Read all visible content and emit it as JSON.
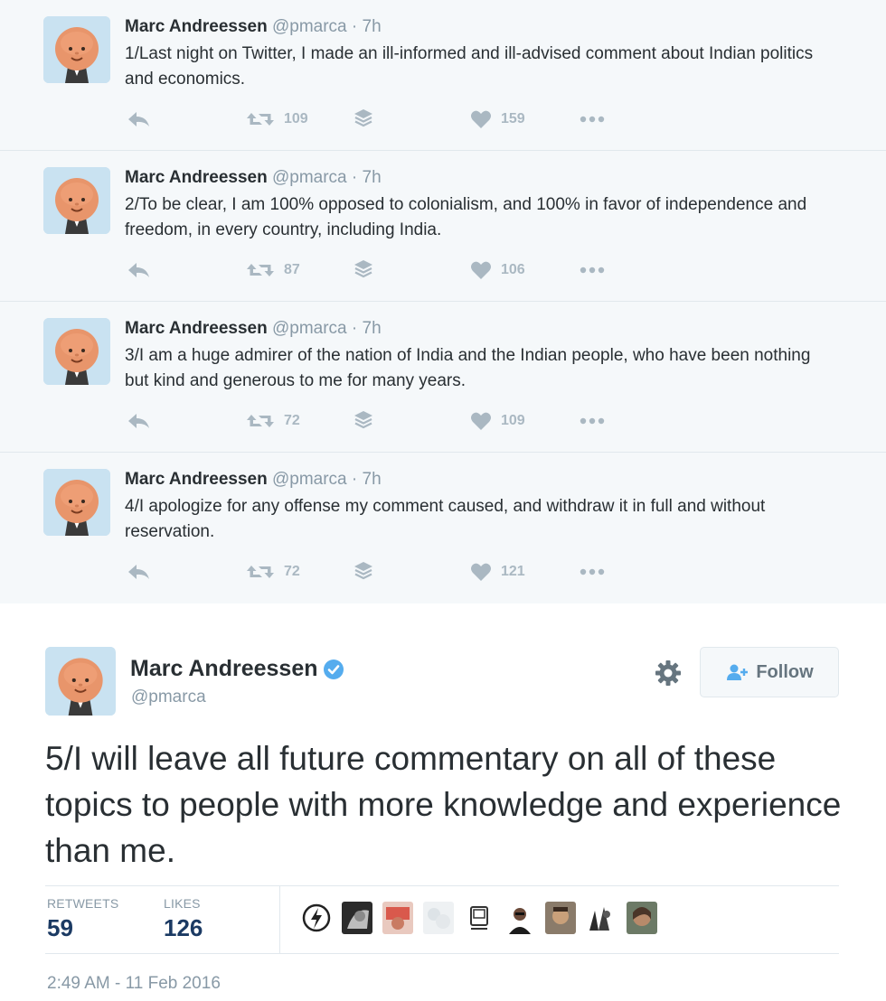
{
  "thread": [
    {
      "name": "Marc Andreessen",
      "handle": "@pmarca",
      "dot": "·",
      "time": "7h",
      "text": "1/Last night on Twitter, I made an ill-informed and ill-advised comment about Indian politics and economics.",
      "retweets": "109",
      "likes": "159"
    },
    {
      "name": "Marc Andreessen",
      "handle": "@pmarca",
      "dot": "·",
      "time": "7h",
      "text": "2/To be clear, I am 100% opposed to colonialism, and 100% in favor of independence and freedom, in every country, including India.",
      "retweets": "87",
      "likes": "106"
    },
    {
      "name": "Marc Andreessen",
      "handle": "@pmarca",
      "dot": "·",
      "time": "7h",
      "text": "3/I am a huge admirer of the nation of India and the Indian people, who have been nothing but kind and generous to me for many years.",
      "retweets": "72",
      "likes": "109"
    },
    {
      "name": "Marc Andreessen",
      "handle": "@pmarca",
      "dot": "·",
      "time": "7h",
      "text": "4/I apologize for any offense my comment caused, and withdraw it in full and without reservation.",
      "retweets": "72",
      "likes": "121"
    }
  ],
  "main_tweet": {
    "name": "Marc Andreessen",
    "handle": "@pmarca",
    "follow_label": "Follow",
    "text": "5/I will leave all future commentary on all of these topics to people with more knowledge and experience than me.",
    "retweets_label": "RETWEETS",
    "retweets_value": "59",
    "likes_label": "LIKES",
    "likes_value": "126",
    "timestamp": "2:49 AM - 11 Feb 2016"
  },
  "icons": {
    "reply": "reply-icon",
    "retweet": "retweet-icon",
    "stack": "layers-icon",
    "like": "heart-icon",
    "more": "more-dots-icon",
    "gear": "gear-icon",
    "follow": "add-user-icon",
    "verified": "verified-badge-icon"
  },
  "colors": {
    "background_thread": "#f5f8fa",
    "text": "#292f33",
    "muted": "#8899a6",
    "action_icon": "#aab8c2",
    "stat_value": "#1b3a63",
    "verified": "#55acee",
    "border": "#e1e8ed"
  }
}
